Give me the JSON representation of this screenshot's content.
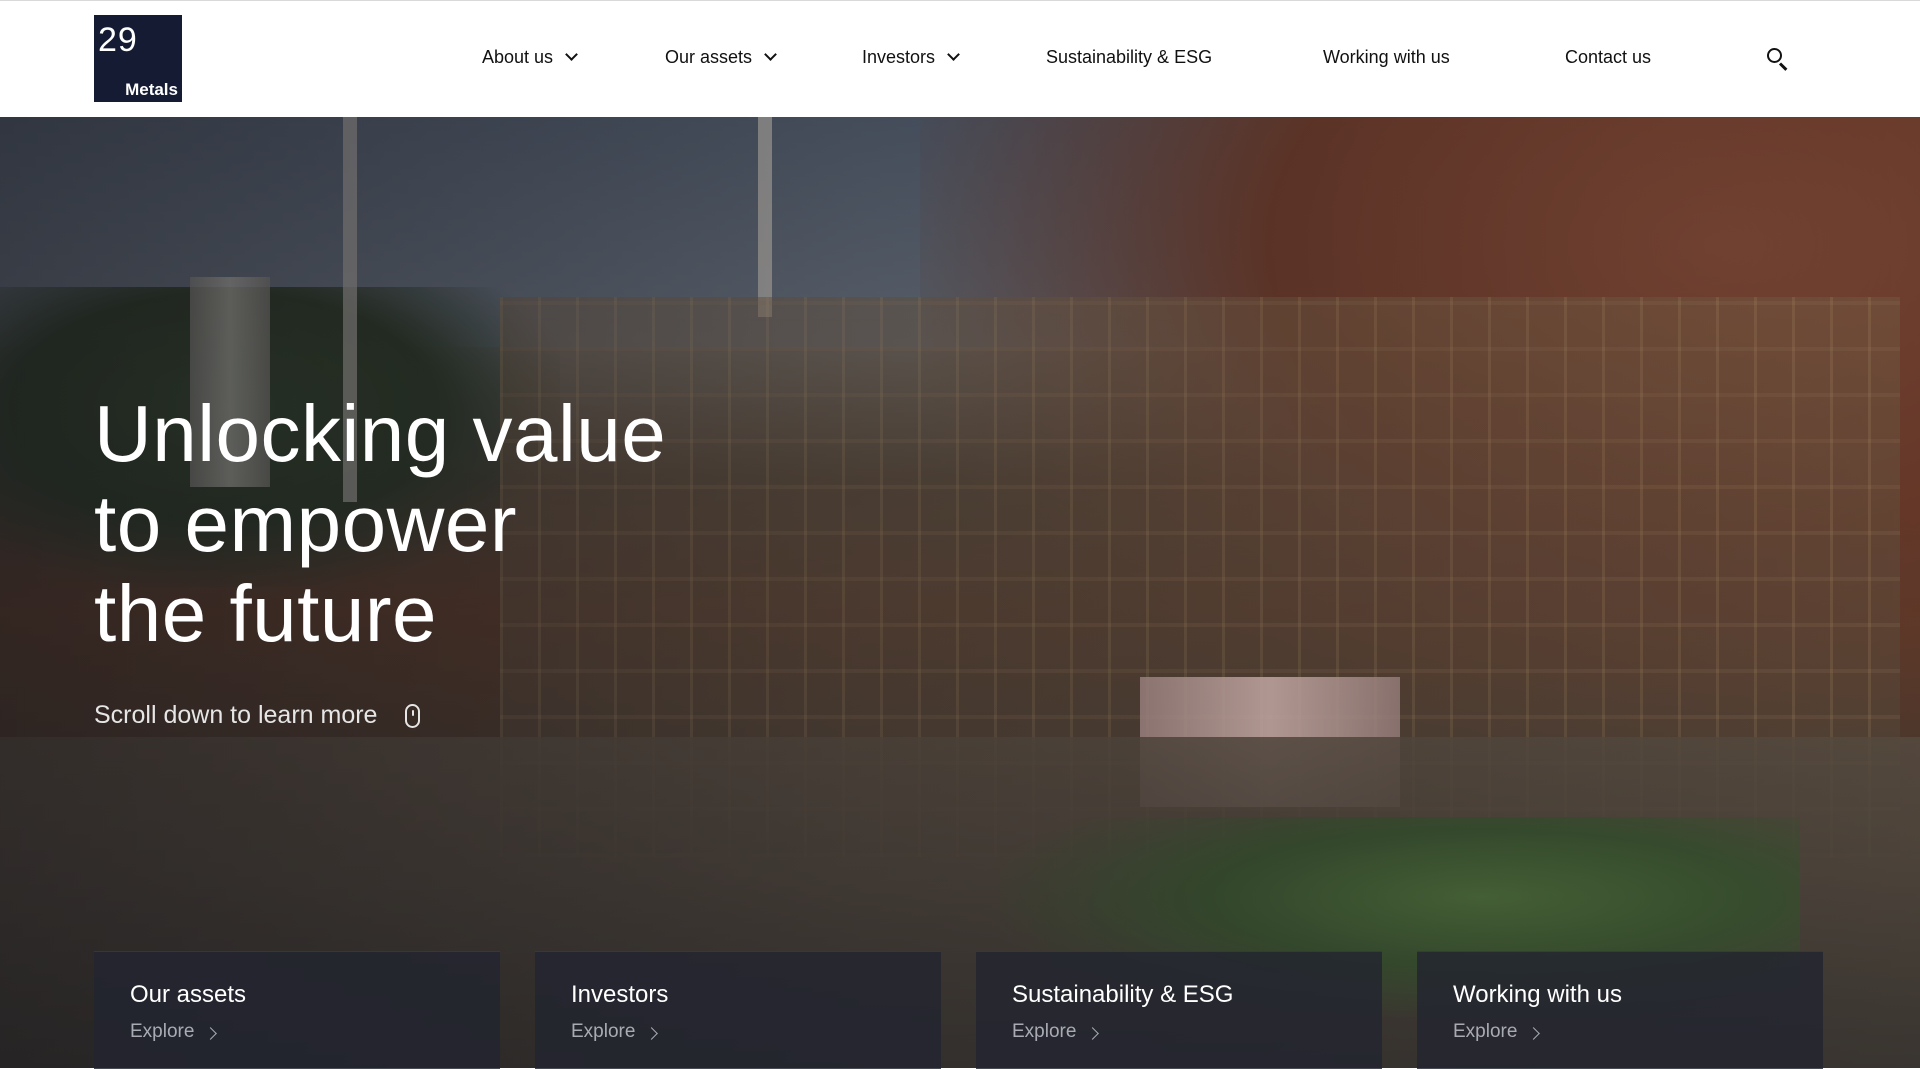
{
  "logo": {
    "number": "29",
    "word": "Metals"
  },
  "nav": {
    "items": [
      {
        "label": "About us",
        "has_dropdown": true
      },
      {
        "label": "Our assets",
        "has_dropdown": true
      },
      {
        "label": "Investors",
        "has_dropdown": true
      },
      {
        "label": "Sustainability & ESG",
        "has_dropdown": false
      },
      {
        "label": "Working with us",
        "has_dropdown": false
      },
      {
        "label": "Contact us",
        "has_dropdown": false
      }
    ],
    "search_icon": "search-icon"
  },
  "hero": {
    "headline_lines": [
      "Unlocking value",
      "to empower",
      "the future"
    ],
    "scroll_hint": "Scroll down to learn more",
    "scroll_icon": "mouse-icon"
  },
  "cards": [
    {
      "title": "Our assets",
      "cta": "Explore"
    },
    {
      "title": "Investors",
      "cta": "Explore"
    },
    {
      "title": "Sustainability & ESG",
      "cta": "Explore"
    },
    {
      "title": "Working with us",
      "cta": "Explore"
    }
  ],
  "colors": {
    "brand_navy": "#141b33",
    "header_bg": "#ffffff",
    "card_bg": "#222430",
    "hero_text": "#ffffff"
  }
}
